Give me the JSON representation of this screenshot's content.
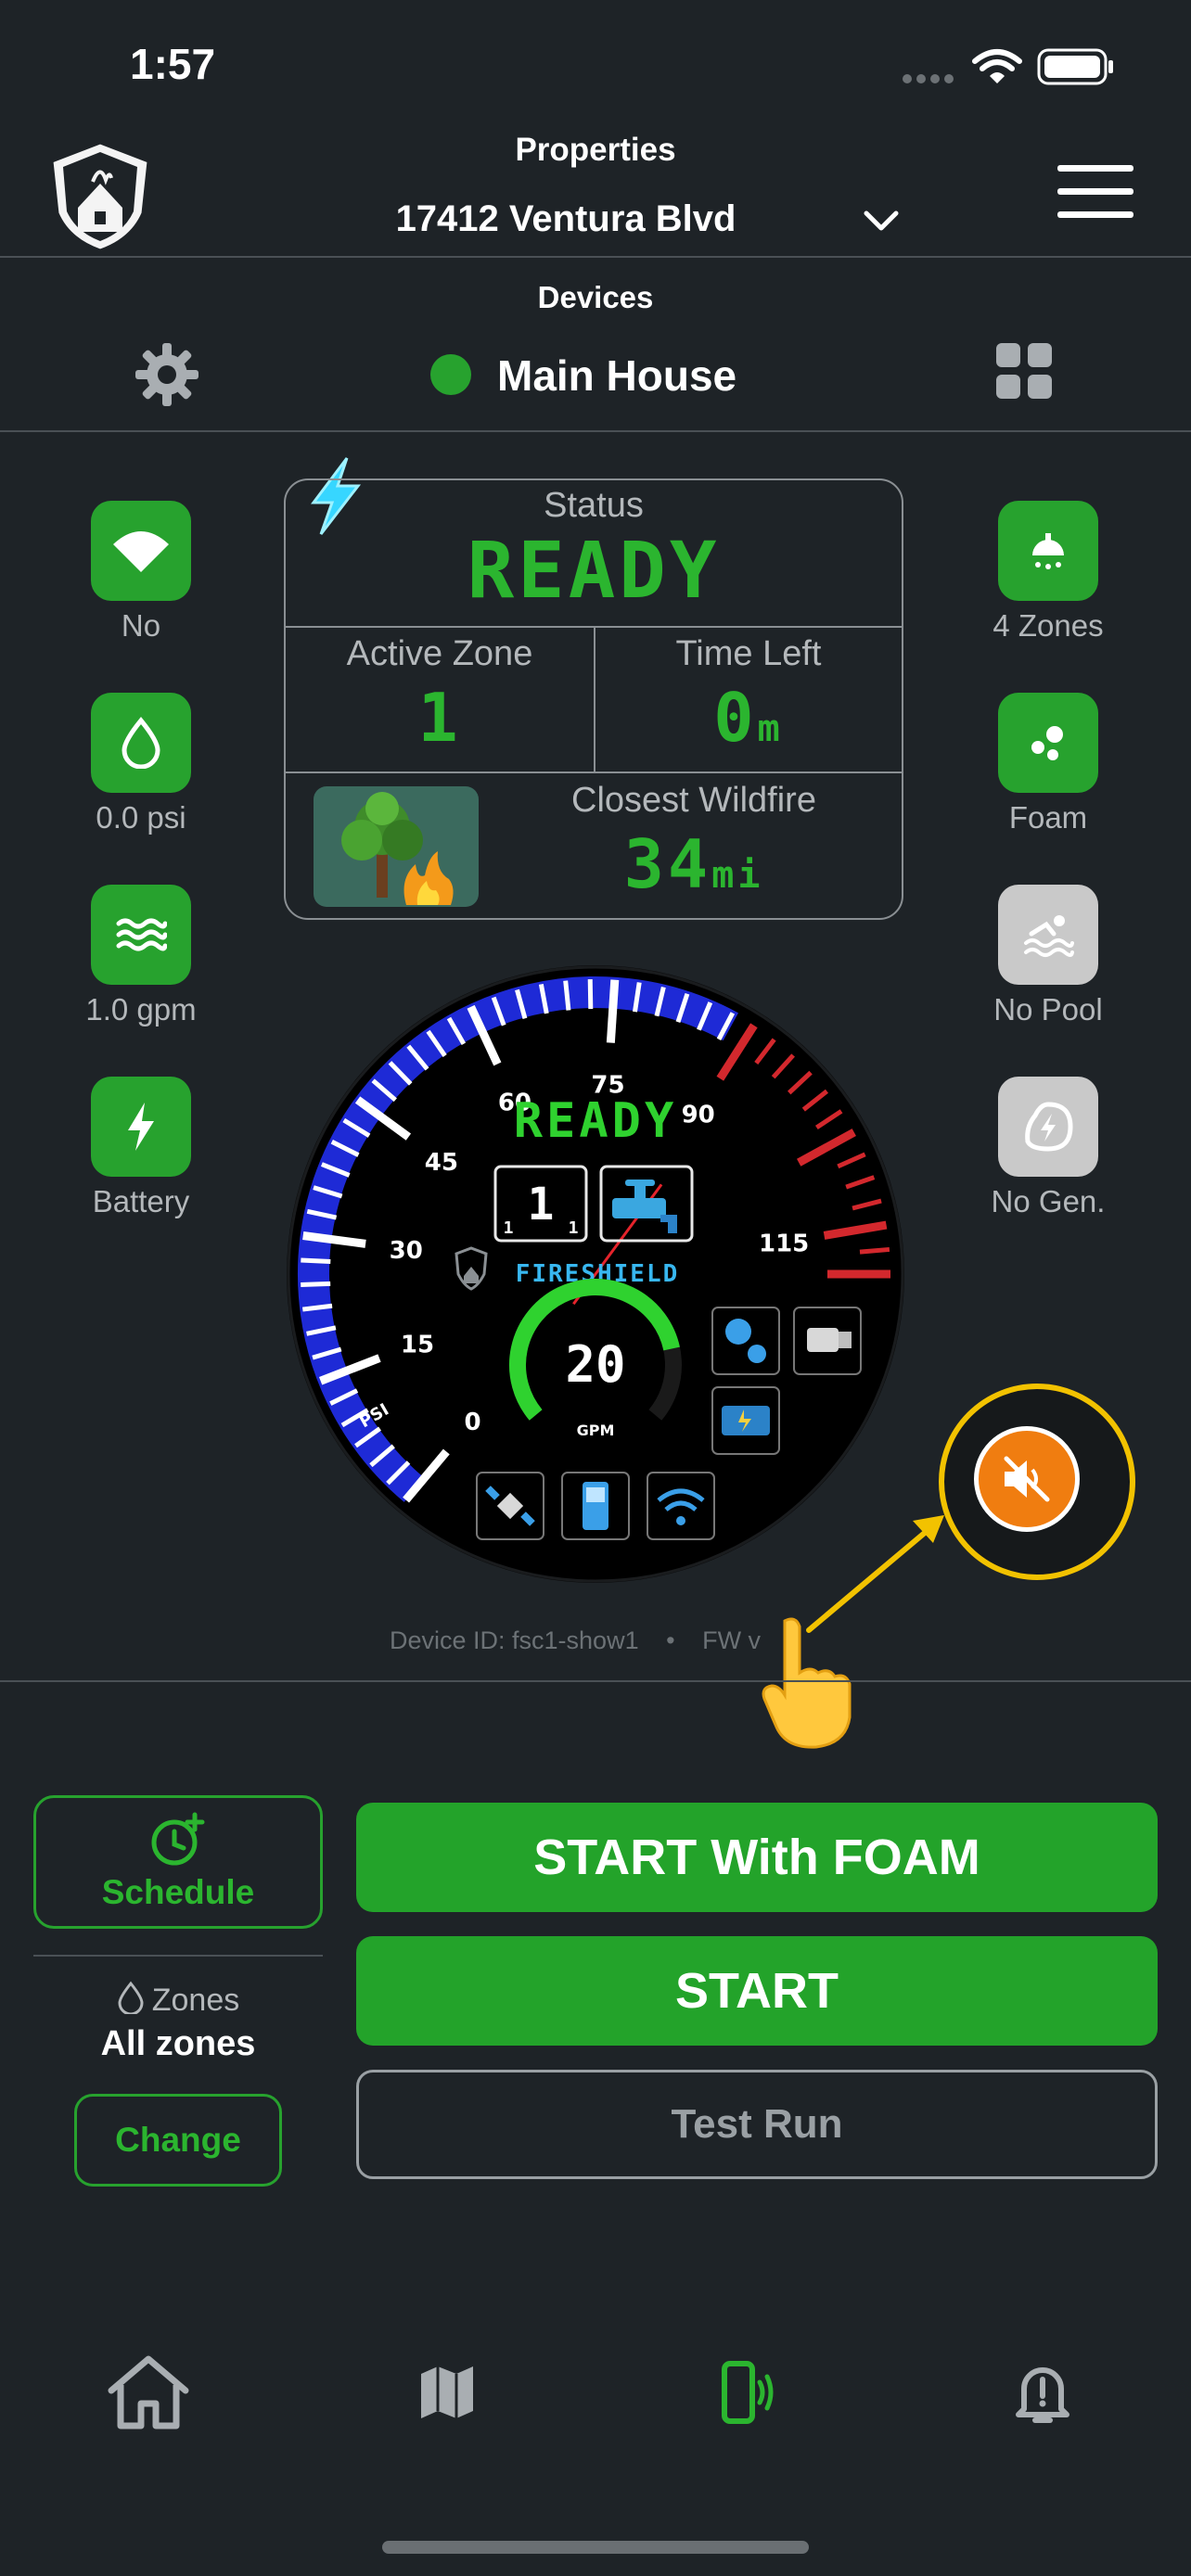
{
  "status_bar": {
    "time": "1:57"
  },
  "header": {
    "title": "Properties",
    "property": "17412 Ventura Blvd"
  },
  "devices": {
    "title": "Devices",
    "current": "Main House",
    "online_color": "#27a22e"
  },
  "left_items": [
    {
      "label": "No",
      "icon": "wifi-icon"
    },
    {
      "label": "0.0 psi",
      "icon": "water-drop-icon"
    },
    {
      "label": "1.0 gpm",
      "icon": "water-waves-icon"
    },
    {
      "label": "Battery",
      "icon": "lightning-icon"
    }
  ],
  "right_items": [
    {
      "label": "4 Zones",
      "icon": "sprinkler-icon"
    },
    {
      "label": "Foam",
      "icon": "foam-bubbles-icon"
    },
    {
      "label": "No Pool",
      "icon": "pool-swimmer-icon"
    },
    {
      "label": "No Gen.",
      "icon": "generator-icon"
    }
  ],
  "status_panel": {
    "status_label": "Status",
    "status_value": "READY",
    "active_zone_label": "Active Zone",
    "active_zone_value": "1",
    "time_left_label": "Time Left",
    "time_left_value": "0",
    "time_left_unit": "m",
    "wildfire_label": "Closest Wildfire",
    "wildfire_value": "34",
    "wildfire_unit": "mi"
  },
  "gauge": {
    "ticks": [
      "0",
      "15",
      "30",
      "45",
      "60",
      "75",
      "90",
      "115"
    ],
    "unit": "PSI",
    "status": "READY",
    "zone_big": "1",
    "zone_small_left": "1",
    "zone_small_right": "1",
    "brand": "FIRESHIELD",
    "flow_value": "20",
    "flow_unit": "GPM",
    "needle_value": 92,
    "flow_level": 0.8,
    "accent_blue": "#1e2ad6",
    "accent_red": "#d3282d",
    "accent_green": "#2fd22f"
  },
  "device_info": {
    "device_id": "Device ID: fsc1-show1",
    "separator": "•",
    "fw": "FW v"
  },
  "actions": {
    "schedule": "Schedule",
    "zones_label": "Zones",
    "zones_value": "All zones",
    "change": "Change",
    "start_foam": "START With FOAM",
    "start": "START",
    "test_run": "Test Run"
  },
  "colors": {
    "background": "#1e2327",
    "green": "#27a22e",
    "mute_orange": "#f07d10",
    "highlight_yellow": "#f2c200"
  }
}
